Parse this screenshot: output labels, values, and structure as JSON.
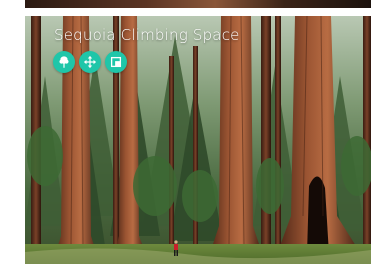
{
  "card": {
    "title": "Sequoia Climbing Space",
    "accent_color": "#1fc6a9",
    "image": "sequoia-forest-photo",
    "actions": [
      {
        "icon": "tree-icon"
      },
      {
        "icon": "move-arrows-icon"
      },
      {
        "icon": "frame-select-icon"
      }
    ]
  }
}
